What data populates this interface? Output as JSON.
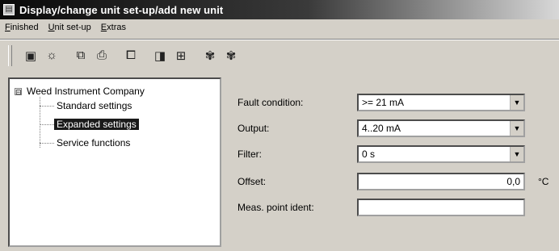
{
  "window": {
    "title": "Display/change unit set-up/add new unit"
  },
  "menu": {
    "items": [
      "Finished",
      "Unit set-up",
      "Extras"
    ]
  },
  "toolbar": {
    "buttons": [
      {
        "icon": "save-icon",
        "glyph": "▣"
      },
      {
        "icon": "tools-icon",
        "glyph": "☼"
      },
      {
        "icon": "copy-icon",
        "glyph": "⧉"
      },
      {
        "icon": "print-icon",
        "glyph": "⎙"
      },
      {
        "icon": "document-icon",
        "glyph": "⧠"
      },
      {
        "icon": "unit-setup-icon",
        "glyph": "◨"
      },
      {
        "icon": "network-icon",
        "glyph": "⊞"
      },
      {
        "icon": "paw-icon-1",
        "glyph": "✾"
      },
      {
        "icon": "paw-icon-2",
        "glyph": "✾"
      }
    ]
  },
  "tree": {
    "root": {
      "label": "Weed Instrument Company",
      "expander": "⊟"
    },
    "children": [
      {
        "label": "Standard settings",
        "selected": false
      },
      {
        "label": "Expanded settings",
        "selected": true
      },
      {
        "label": "Service functions",
        "selected": false
      }
    ]
  },
  "form": {
    "fault_condition": {
      "label": "Fault condition:",
      "value": ">= 21 mA"
    },
    "output": {
      "label": "Output:",
      "value": "4..20 mA"
    },
    "filter": {
      "label": "Filter:",
      "value": "0 s"
    },
    "offset": {
      "label": "Offset:",
      "value": "0,0",
      "unit": "°C"
    },
    "meas_point_ident": {
      "label": "Meas. point ident:",
      "value": ""
    }
  }
}
